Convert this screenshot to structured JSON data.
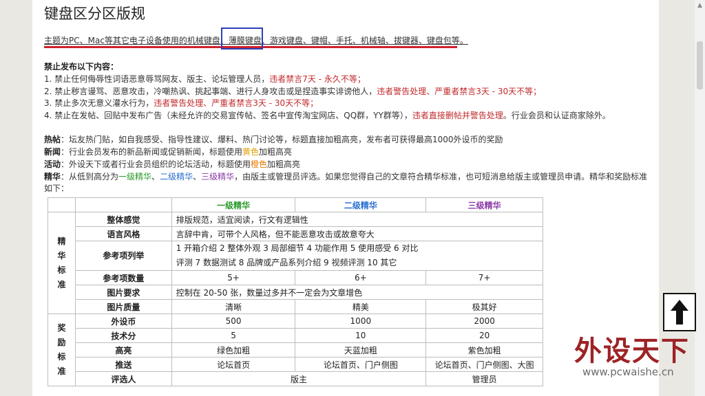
{
  "page": {
    "title": "键盘区分区版规",
    "topic_line": "主题为PC、Mac等其它电子设备使用的机械键盘、薄膜键盘、游戏键盘、键帽、手托、机械轴、拔键器、键盘包等。"
  },
  "rules": {
    "heading": "禁止发布以下内容：",
    "items": [
      {
        "text": "1. 禁止任何侮辱性词语恶意辱骂网友、版主、论坛管理人员，",
        "penalty": "违者禁言7天 - 永久不等；"
      },
      {
        "text": "2. 禁止秽言谩骂、恶意攻击，冷嘲热讽、挑起事端、进行人身攻击或是捏造事实诽谤他人，",
        "penalty": "违者警告处理、严重者禁言3天 - 30天不等；"
      },
      {
        "text": "3. 禁止多次无意义灌水行为，",
        "penalty": "违者警告处理、严重者禁言3天 - 30天不等；"
      },
      {
        "text": "4. 禁止在发帖、回贴中发布广告（未经允许的交易宣传帖、签名中宣传淘宝网店、QQ群，YY群等），",
        "penalty": "违者直接删帖并警告处理",
        "suffix": "。行业会员和认证商家除外。"
      }
    ]
  },
  "definitions": {
    "hot": {
      "label": "热帖",
      "text": "：坛友热门贴，如自我感受、指导性建议、爆料、热门讨论等，标题直接加粗高亮，发布者可获得最高1000外设币的奖励"
    },
    "news": {
      "label": "新闻",
      "text_a": "：行业会员发布的新品新闻或促销新闻，标题使用",
      "color_word": "黄色",
      "text_b": "加粗高亮"
    },
    "event": {
      "label": "活动",
      "text_a": "：外设天下或者行业会员组织的论坛活动，标题使用",
      "color_word": "橙色",
      "text_b": "加粗高亮"
    },
    "essence": {
      "label": "精华",
      "text_a": "：从低到高分为一",
      "g1": "一级精华",
      "sep1": "、",
      "g2": "二级精华",
      "sep2": "、",
      "g3": "三级精华",
      "text_b": "，由版主或管理员评选。如果您觉得自己的文章符合精华标准，也可短消息给版主或管理员申请。精华和奖励标准",
      "line2": "如下："
    }
  },
  "table": {
    "headers": [
      "",
      "",
      "一级精华",
      "二级精华",
      "三级精华"
    ],
    "group_essence": "精华标准",
    "group_reward": "奖励标准",
    "rows": {
      "overall": {
        "label": "整体感觉",
        "value": "排版规范，适宜阅读，行文有逻辑性"
      },
      "style": {
        "label": "语言风格",
        "value": "言辞中肯，可带个人风格，但不能恶意攻击或故意夸大"
      },
      "items": {
        "label": "参考项列举",
        "value": "1 开箱介绍  2 整体外观  3 局部细节  4 功能作用  5 使用感受  6 对比评测  7 数据测试  8 品牌或产品系列介绍  9 视频评测  10 其它"
      },
      "count": {
        "label": "参考项数量",
        "v1": "5+",
        "v2": "6+",
        "v3": "7+"
      },
      "pics": {
        "label": "图片要求",
        "value": "控制在 20-50 张，数量过多并不一定会为文章增色"
      },
      "quality": {
        "label": "图片质量",
        "v1": "清晰",
        "v2": "精美",
        "v3": "极其好"
      },
      "coins": {
        "label": "外设币",
        "v1": "500",
        "v2": "1000",
        "v3": "2000"
      },
      "tech": {
        "label": "技术分",
        "v1": "5",
        "v2": "10",
        "v3": "20"
      },
      "highlight": {
        "label": "高亮",
        "v1": "绿色加粗",
        "v2": "天蓝加粗",
        "v3": "紫色加粗"
      },
      "push": {
        "label": "推送",
        "v1": "论坛首页",
        "v2": "论坛首页、门户侧图",
        "v3": "论坛首页、门户侧图、大图"
      },
      "judge": {
        "label": "评选人",
        "v12": "版主",
        "v3": "管理员"
      }
    }
  },
  "watermark": {
    "logo": "外设天下",
    "url": "www.pcwaishe.cn"
  },
  "colors": {
    "red_mark": "#d0202a",
    "blue_box": "#2b3fb8",
    "essence1": "#2a9a2a",
    "essence2": "#2a6fd0",
    "essence3": "#8a3aa8"
  }
}
